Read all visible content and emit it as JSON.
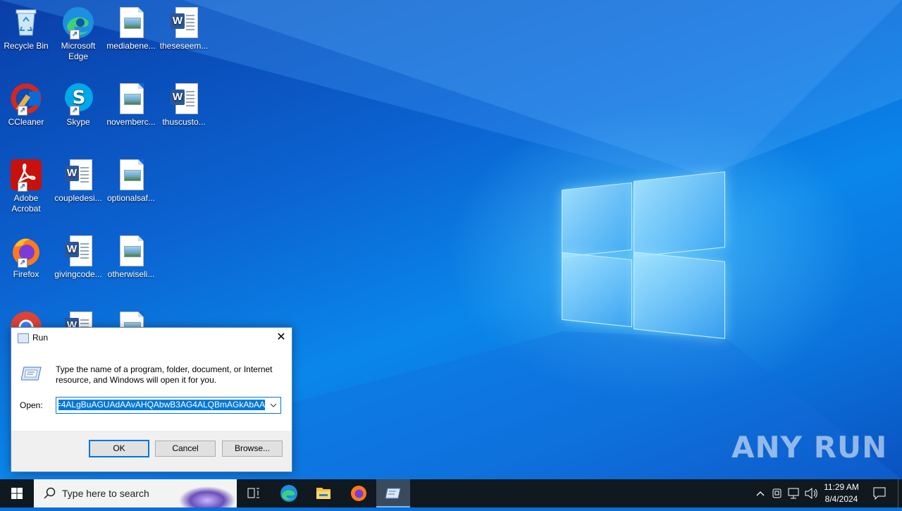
{
  "desktop_icons": [
    {
      "label": "Recycle Bin",
      "icon": "recycle-bin-icon"
    },
    {
      "label": "Microsoft Edge",
      "icon": "edge-icon"
    },
    {
      "label": "mediabene...",
      "icon": "image-file-icon"
    },
    {
      "label": "theseseem...",
      "icon": "word-file-icon"
    },
    {
      "label": "CCleaner",
      "icon": "ccleaner-icon"
    },
    {
      "label": "Skype",
      "icon": "skype-icon"
    },
    {
      "label": "novemberc...",
      "icon": "image-file-icon"
    },
    {
      "label": "thuscusto...",
      "icon": "word-file-icon"
    },
    {
      "label": "Adobe Acrobat",
      "icon": "acrobat-icon"
    },
    {
      "label": "coupledesi...",
      "icon": "word-file-icon"
    },
    {
      "label": "optionalsaf...",
      "icon": "image-file-icon"
    },
    {
      "label": "Firefox",
      "icon": "firefox-icon"
    },
    {
      "label": "givingcode...",
      "icon": "word-file-icon"
    },
    {
      "label": "otherwiseli...",
      "icon": "image-file-icon"
    }
  ],
  "run_dialog": {
    "title": "Run",
    "message": "Type the name of a program, folder, document, or Internet resource, and Windows will open it for you.",
    "open_label": "Open:",
    "open_value": "4ALgBuAGUAdAAvAHQAbwB3AG4ALQBmAGkAbAA=",
    "ok_label": "OK",
    "cancel_label": "Cancel",
    "browse_label": "Browse..."
  },
  "taskbar": {
    "search_placeholder": "Type here to search",
    "time": "11:29 AM",
    "date": "8/4/2024"
  },
  "watermark": "ANY RUN"
}
